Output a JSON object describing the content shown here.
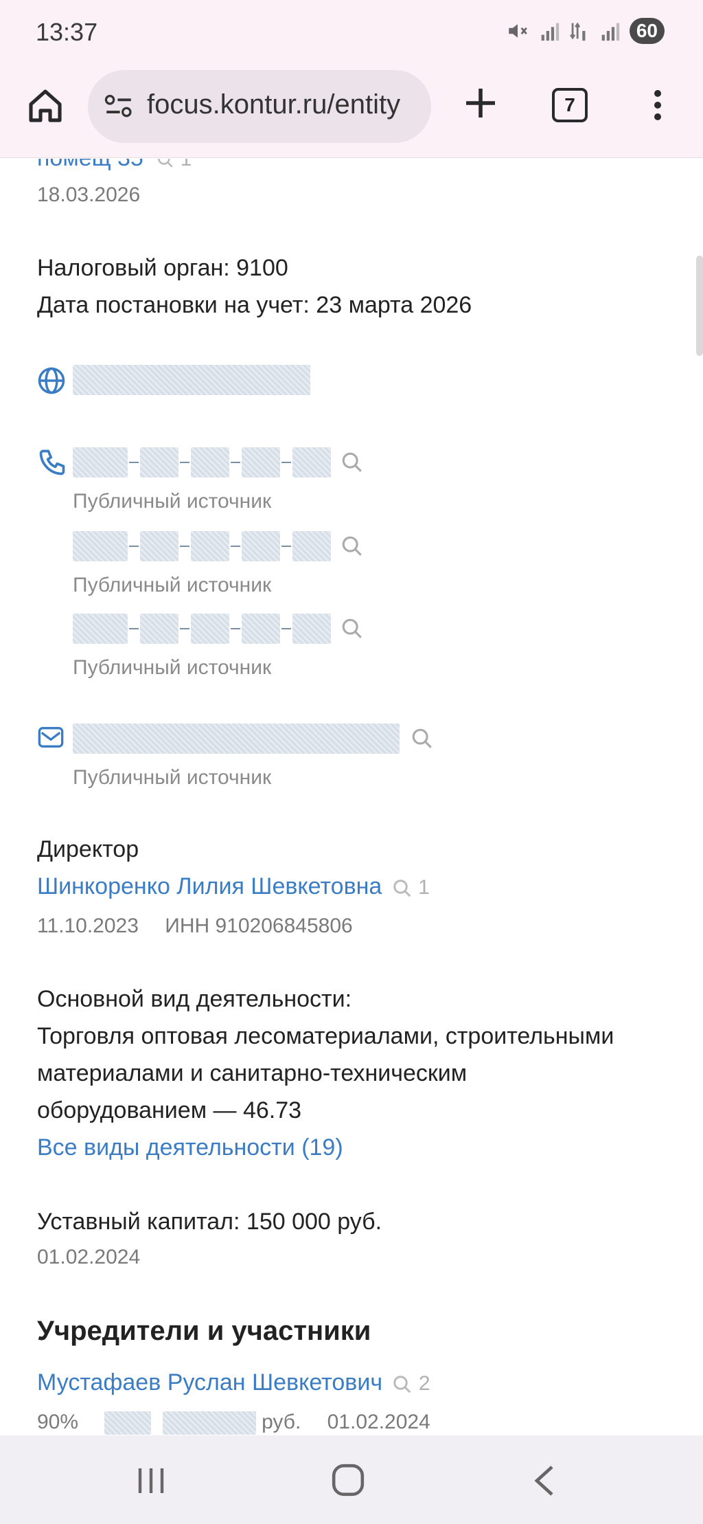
{
  "status_bar": {
    "time": "13:37",
    "battery": "60"
  },
  "browser": {
    "url": "focus.kontur.ru/entity",
    "tab_count": "7"
  },
  "content": {
    "top_partial_link": "помещ 35",
    "top_partial_count": "1",
    "top_date": "18.03.2026",
    "tax_authority": "Налоговый орган: 9100",
    "registration_date": "Дата постановки на учет: 23 марта 2026",
    "phones": [
      {
        "source": "Публичный источник"
      },
      {
        "source": "Публичный источник"
      },
      {
        "source": "Публичный источник"
      }
    ],
    "email": {
      "source": "Публичный источник"
    },
    "director": {
      "label": "Директор",
      "name": "Шинкоренко Лилия Шевкетовна",
      "count": "1",
      "date": "11.10.2023",
      "inn": "ИНН 910206845806"
    },
    "activity": {
      "label": "Основной вид деятельности:",
      "line1": "Торговля оптовая лесоматериалами, строительными",
      "line2": "материалами и санитарно-техническим",
      "line3": "оборудованием — 46.73",
      "all_link": "Все виды деятельности (19)"
    },
    "capital": {
      "text": "Уставный капитал: 150 000 руб.",
      "date": "01.02.2024"
    },
    "founders": {
      "heading": "Учредители и участники",
      "items": [
        {
          "name": "Мустафаев Руслан Шевкетович",
          "count": "2",
          "share": "90%",
          "currency": "руб.",
          "date": "01.02.2024"
        }
      ]
    }
  },
  "colors": {
    "link": "#3a7dc4",
    "chrome": "#fbf1f7",
    "muted": "#8a8a8a"
  }
}
